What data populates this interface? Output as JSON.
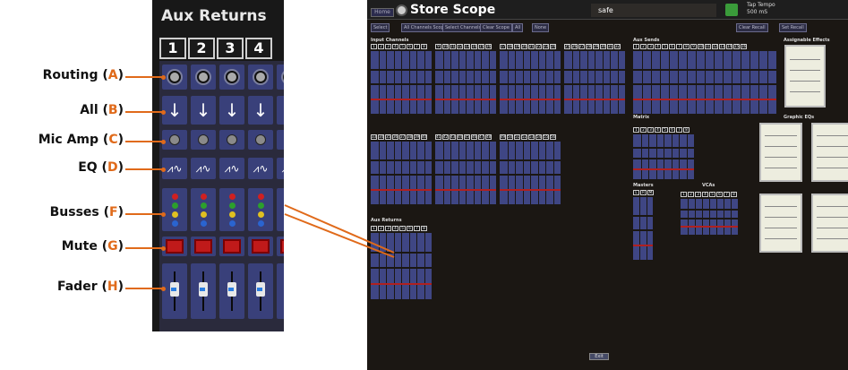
{
  "left_panel": {
    "title": "Aux Returns",
    "channel_numbers": [
      "1",
      "2",
      "3",
      "4"
    ]
  },
  "callouts": [
    {
      "name": "Routing",
      "letter": "A"
    },
    {
      "name": "All",
      "letter": "B"
    },
    {
      "name": "Mic Amp",
      "letter": "C"
    },
    {
      "name": "EQ",
      "letter": "D"
    },
    {
      "name": "Busses",
      "letter": "F"
    },
    {
      "name": "Mute",
      "letter": "G"
    },
    {
      "name": "Fader",
      "letter": "H"
    }
  ],
  "colors": {
    "callout_accent": "#e06a1a",
    "strip_blue": "#39407a",
    "mute_red": "#c01a1a",
    "bus_dots": [
      "#d02020",
      "#2ca02c",
      "#e0c020",
      "#2a64d0"
    ]
  },
  "screen": {
    "home_button": "Home",
    "title": "Store Scope",
    "safe_label": "safe",
    "tap_tempo_label": "Tap Tempo",
    "tap_tempo_value": "500 mS",
    "toolbar_buttons": [
      "Select",
      "All Channels Scope",
      "Select Channels",
      "Clear Scope",
      "All",
      "None",
      "Clear Recall",
      "Set Recall"
    ],
    "sections": {
      "input_channels": "Input Channels",
      "aux_sends": "Aux Sends",
      "assignable_effects": "Assignable Effects",
      "graphic_eqs": "Graphic EQs",
      "matrix": "Matrix",
      "masters": "Masters",
      "vcas": "VCAs",
      "aux_returns": "Aux Returns"
    },
    "input_channel_groups": [
      [
        "1",
        "2",
        "3",
        "4",
        "5",
        "6",
        "7",
        "8"
      ],
      [
        "9",
        "10",
        "11",
        "12",
        "13",
        "14",
        "15",
        "16"
      ],
      [
        "17",
        "18",
        "19",
        "20",
        "21",
        "22",
        "23",
        "24"
      ],
      [
        "25",
        "26",
        "27",
        "28",
        "29",
        "30",
        "31",
        "32"
      ],
      [
        "33",
        "34",
        "35",
        "36",
        "37",
        "38",
        "39",
        "40"
      ],
      [
        "41",
        "42",
        "43",
        "44",
        "45",
        "46",
        "47",
        "48"
      ],
      [
        "49",
        "50",
        "51",
        "52",
        "53",
        "54",
        "55",
        "56"
      ]
    ],
    "aux_send_numbers": [
      "1",
      "2",
      "3",
      "4",
      "5",
      "6",
      "7",
      "8",
      "9",
      "10",
      "11",
      "12",
      "13",
      "14",
      "15",
      "16"
    ],
    "matrix_numbers": [
      "1",
      "2",
      "3",
      "4",
      "5",
      "6",
      "7",
      "8"
    ],
    "master_labels": [
      "L",
      "R",
      "M"
    ],
    "vca_numbers": [
      "1",
      "2",
      "3",
      "4",
      "5",
      "6",
      "7",
      "8"
    ],
    "aux_return_numbers": [
      "1",
      "2",
      "3",
      "4",
      "5",
      "6",
      "7",
      "8"
    ],
    "exit_button": "Exit"
  }
}
